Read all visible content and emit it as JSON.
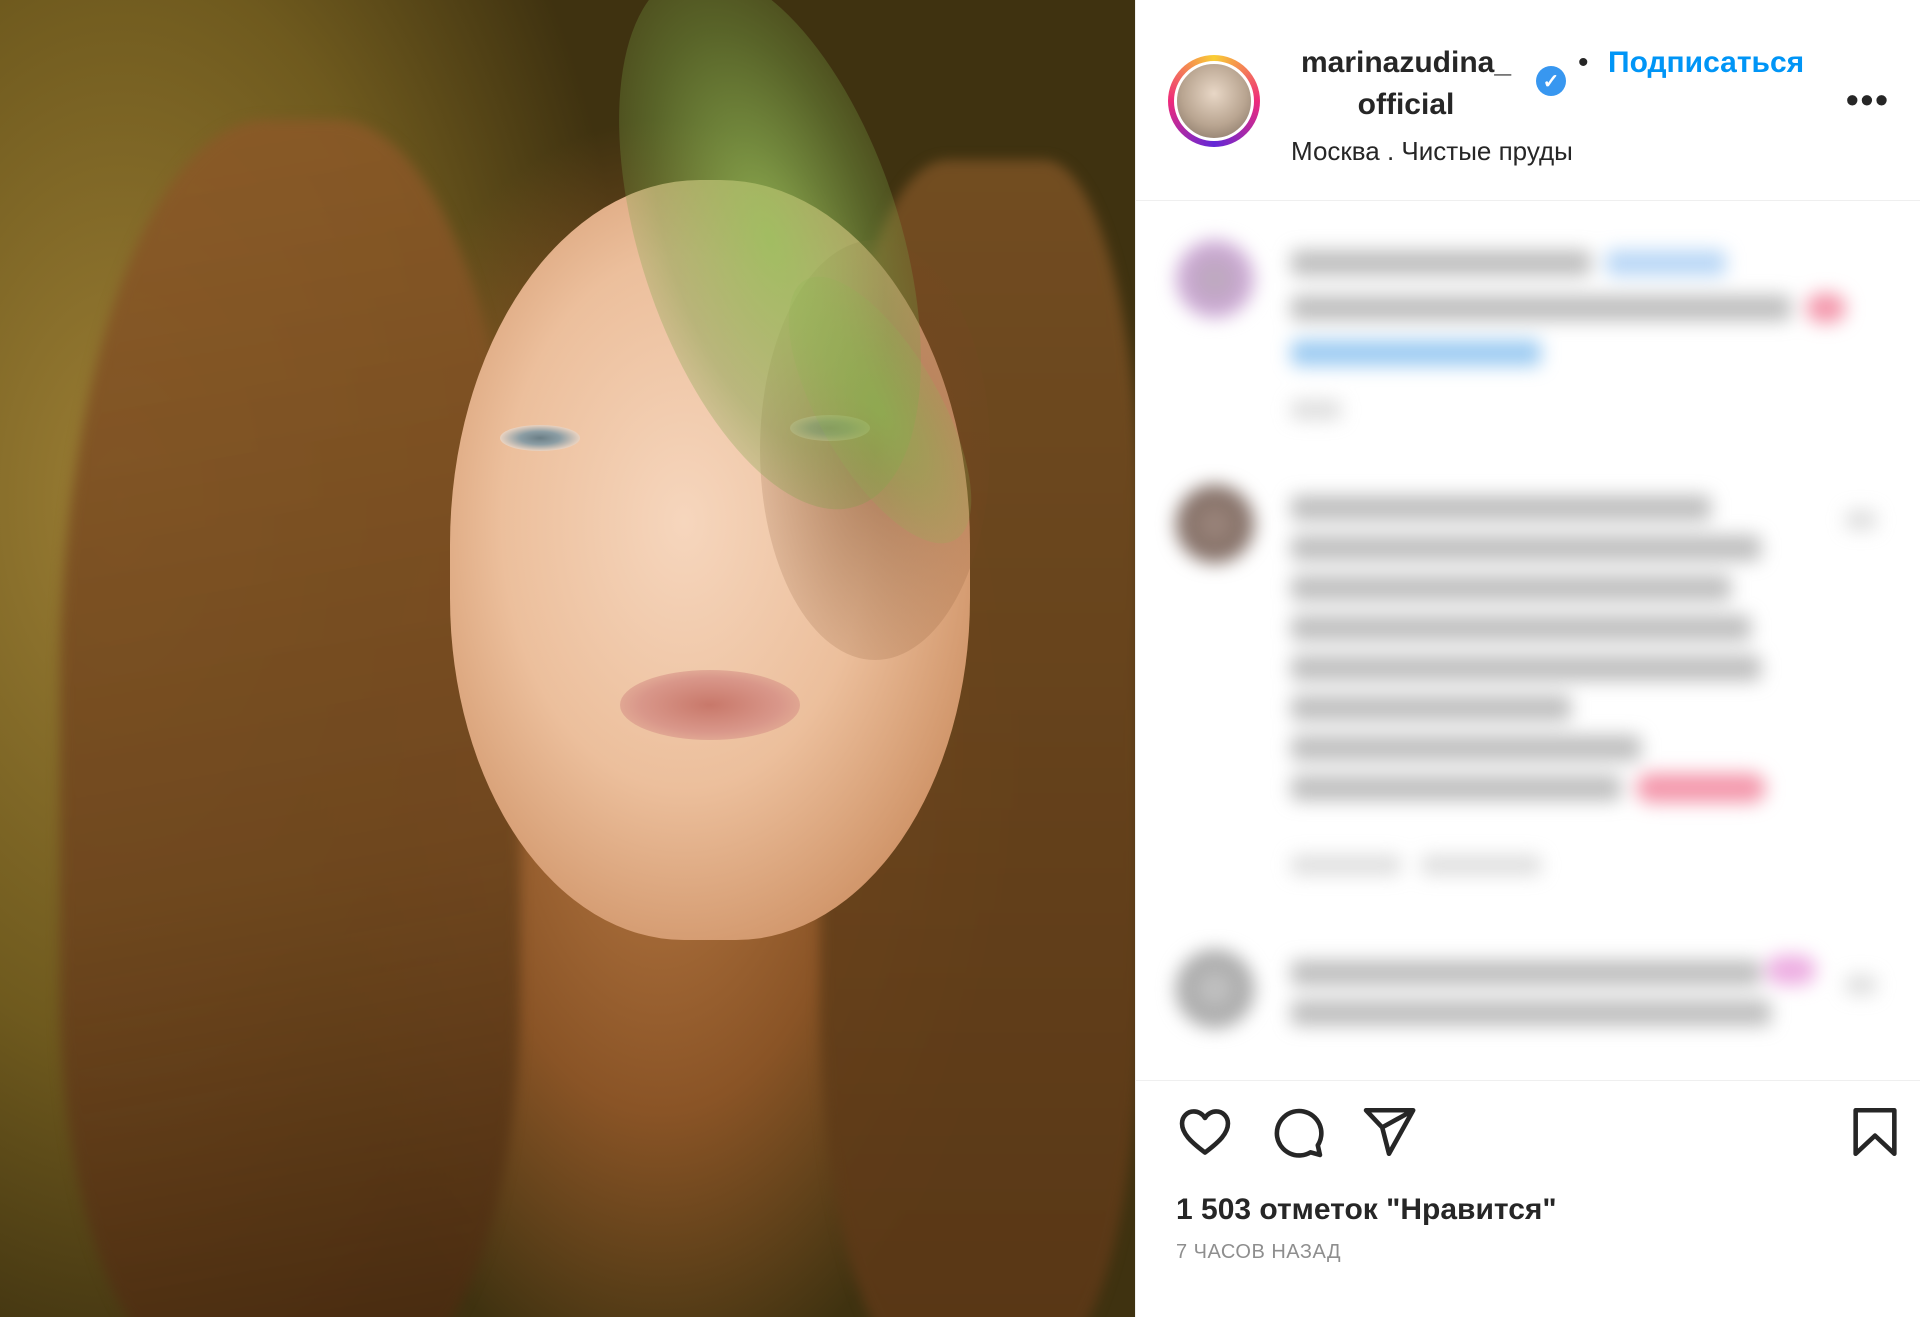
{
  "post": {
    "image_alt": "portrait photo",
    "header": {
      "username_line1": "marinazudina_",
      "username_line2": "official",
      "separator": "•",
      "follow_label": "Подписаться",
      "more_label": "•••",
      "location": "Москва . Чистые пруды",
      "verified_icon": "✓"
    },
    "footer": {
      "likes_text": "1 503 отметок \"Нравится\"",
      "time_text": "7 ЧАСОВ НАЗАД"
    },
    "icons": {
      "like": "heart-icon",
      "comment": "comment-icon",
      "share": "share-icon",
      "save": "bookmark-icon"
    },
    "colors": {
      "accent": "#0095f6",
      "text": "#262626",
      "muted": "#8e8e8e",
      "verified": "#3897f0"
    }
  }
}
